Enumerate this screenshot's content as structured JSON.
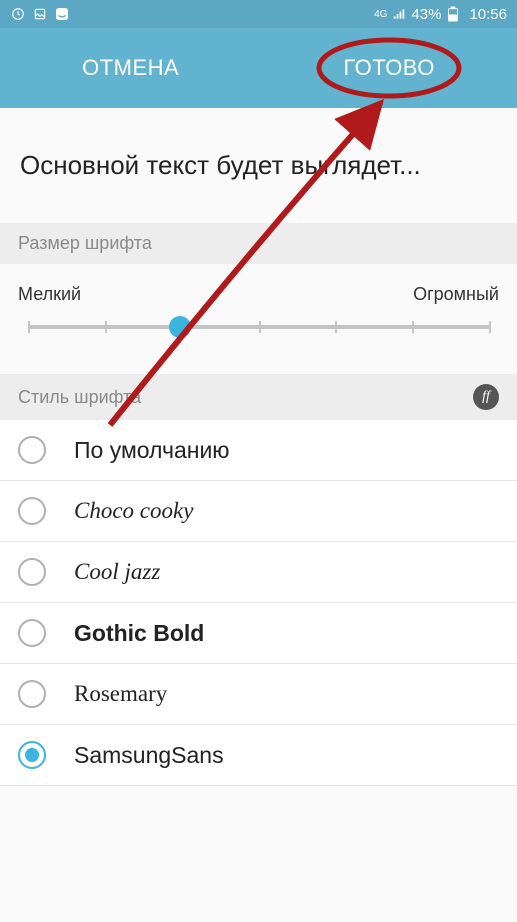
{
  "status_bar": {
    "network_label": "4G",
    "battery": "43%",
    "time": "10:56"
  },
  "header": {
    "cancel": "ОТМЕНА",
    "done": "ГОТОВО"
  },
  "preview": {
    "text": "Основной текст будет выглядет..."
  },
  "font_size": {
    "section_label": "Размер шрифта",
    "min_label": "Мелкий",
    "max_label": "Огромный",
    "slider_percent": 33
  },
  "font_style": {
    "section_label": "Стиль шрифта",
    "badge": "ff",
    "options": [
      {
        "label": "По умолчанию",
        "selected": false,
        "css": "font-family: sans-serif;"
      },
      {
        "label": "Choco cooky",
        "selected": false,
        "css": "font-family: 'Comic Sans MS', cursive; font-style: italic;"
      },
      {
        "label": "Cool jazz",
        "selected": false,
        "css": "font-family: cursive; font-style: italic;"
      },
      {
        "label": "Gothic Bold",
        "selected": false,
        "css": "font-family: sans-serif; font-weight: bold;"
      },
      {
        "label": "Rosemary",
        "selected": false,
        "css": "font-family: cursive;"
      },
      {
        "label": "SamsungSans",
        "selected": true,
        "css": "font-family: sans-serif;"
      }
    ]
  },
  "annotation": {
    "ellipse_color": "#b11a1a",
    "arrow_color": "#b11a1a"
  }
}
